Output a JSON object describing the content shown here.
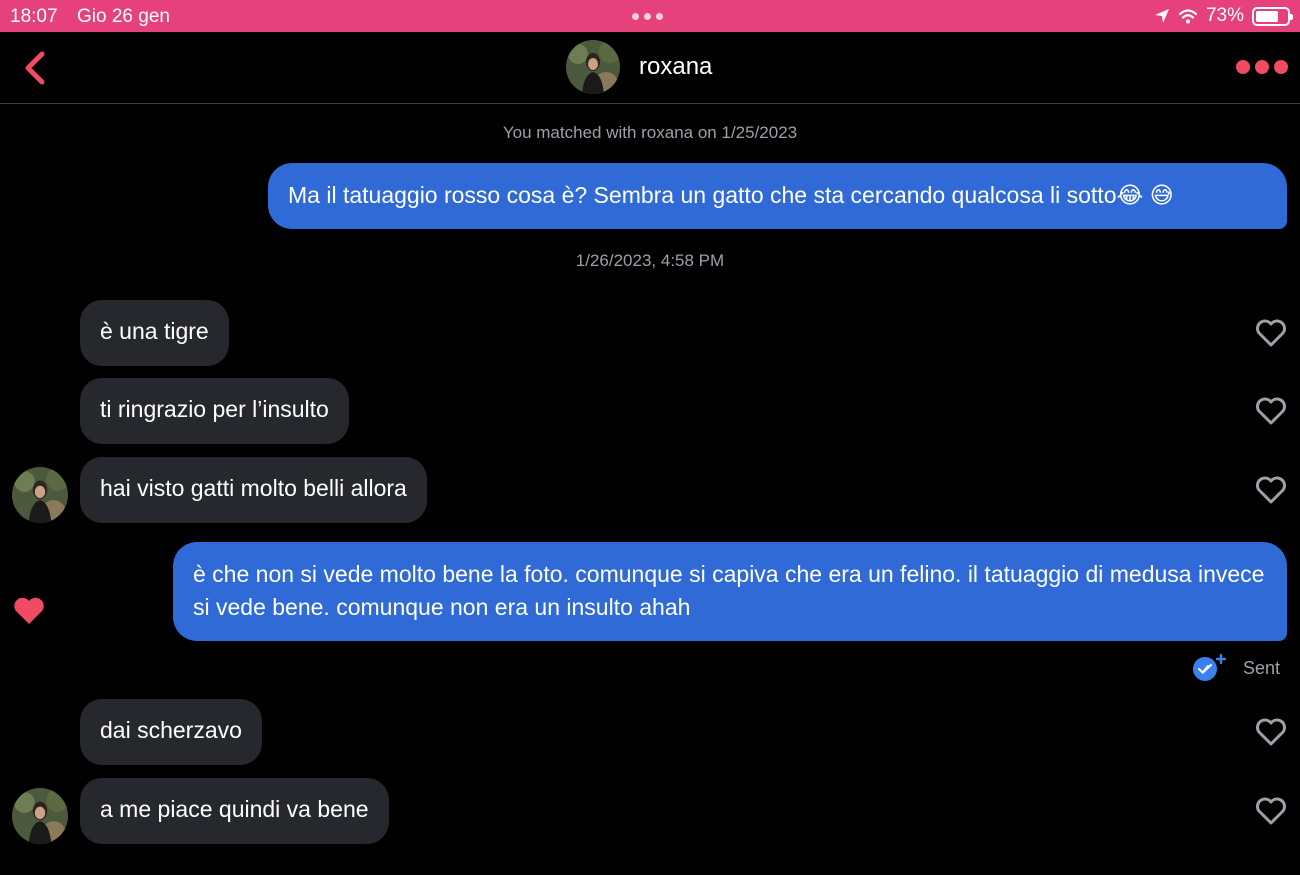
{
  "status_bar": {
    "time": "18:07",
    "date": "Gio 26 gen",
    "battery_pct": "73%",
    "battery_level": 0.73
  },
  "header": {
    "contact_name": "roxana",
    "accent_color": "#f04b63"
  },
  "chat": {
    "match_notice": "You matched with roxana on 1/25/2023",
    "timestamp": "1/26/2023, 4:58 PM",
    "messages": [
      {
        "direction": "outgoing",
        "text": "Ma il tatuaggio rosso cosa è? Sembra un gatto che sta cercando qualcosa li sotto😂 😅"
      },
      {
        "direction": "incoming",
        "text": "è una tigre"
      },
      {
        "direction": "incoming",
        "text": "ti ringrazio per l’insulto"
      },
      {
        "direction": "incoming",
        "text": "hai visto gatti molto belli allora"
      },
      {
        "direction": "outgoing",
        "text": "è che non si vede molto bene la foto. comunque si capiva che era un felino. il tatuaggio di medusa invece si vede bene. comunque non era un insulto ahah",
        "liked": true
      },
      {
        "direction": "incoming",
        "text": "dai scherzavo"
      },
      {
        "direction": "incoming",
        "text": "a me piace quindi va bene"
      }
    ],
    "delivery_status": "Sent"
  },
  "colors": {
    "status_bar": "#e6417a",
    "outgoing_bubble": "#2f6ad6",
    "incoming_bubble": "#26282e",
    "like_heart": "#f04b63"
  }
}
